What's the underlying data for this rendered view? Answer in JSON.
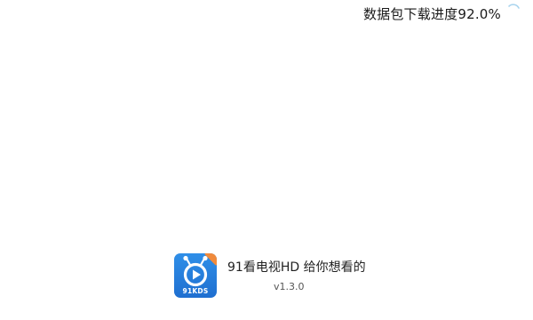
{
  "status": {
    "download_progress_text": "数据包下载进度92.0%",
    "download_progress": 0.92,
    "loading_icon": "loading-spinner-icon"
  },
  "brand": {
    "app_icon": "91kds-app-icon",
    "icon_label": "91KDS",
    "slogan": "91看电视HD 给你想看的",
    "version": "v1.3.0",
    "colors": {
      "icon_blue": "#2f8fe8",
      "icon_corner_orange": "#f08a3c"
    }
  }
}
